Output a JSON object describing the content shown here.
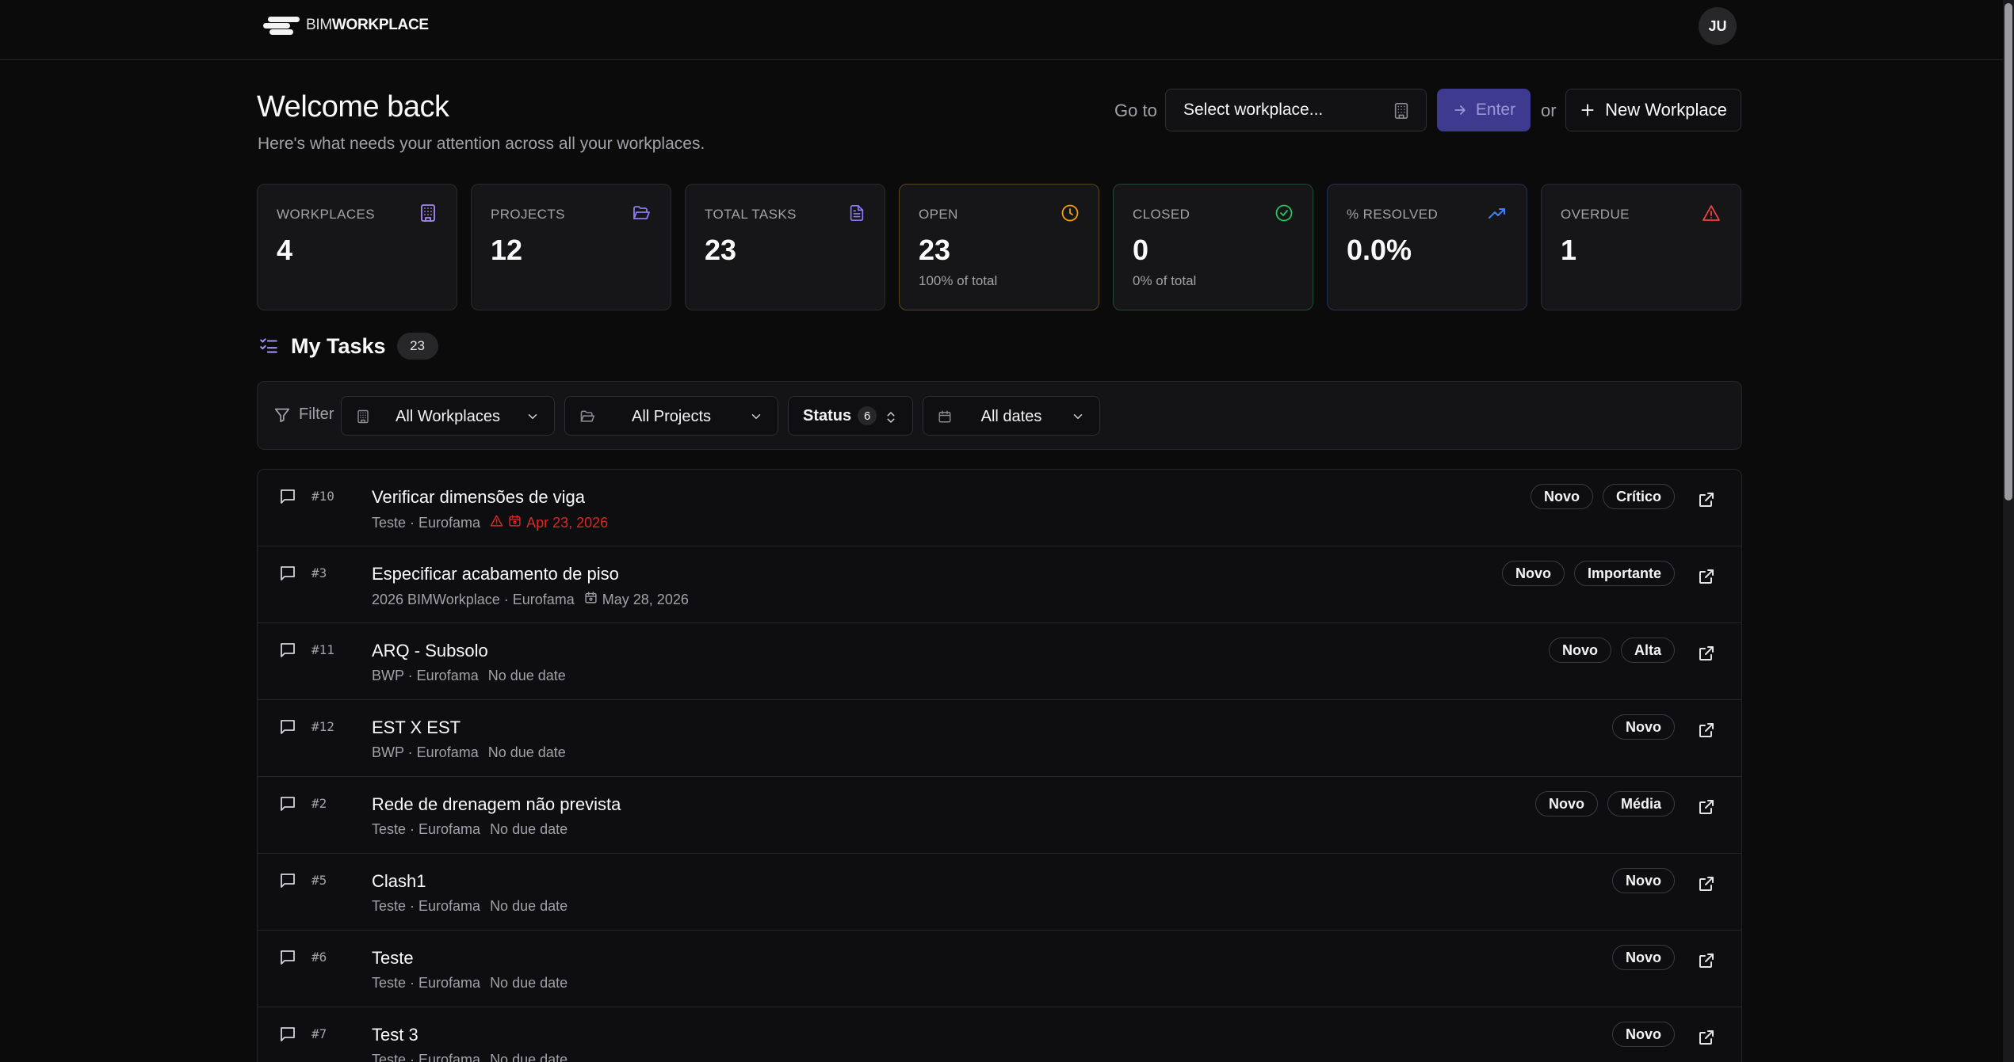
{
  "header": {
    "logo_part1": "BIM",
    "logo_part2": "WORKPLACE",
    "avatar_initials": "JU"
  },
  "welcome": {
    "title": "Welcome back",
    "subtitle": "Here's what needs your attention across all your workplaces."
  },
  "goto": {
    "label": "Go to",
    "select_placeholder": "Select workplace...",
    "enter_label": "Enter",
    "or_label": "or",
    "new_label": "New Workplace"
  },
  "stats": [
    {
      "label": "WORKPLACES",
      "value": "4",
      "sub": "",
      "icon": "building-icon",
      "color": "#a78bfa"
    },
    {
      "label": "PROJECTS",
      "value": "12",
      "sub": "",
      "icon": "folder-open-icon",
      "color": "#8b7cf6"
    },
    {
      "label": "TOTAL TASKS",
      "value": "23",
      "sub": "",
      "icon": "file-text-icon",
      "color": "#8b7cf6"
    },
    {
      "label": "OPEN",
      "value": "23",
      "sub": "100% of total",
      "icon": "clock-icon",
      "color": "#f59e0b"
    },
    {
      "label": "CLOSED",
      "value": "0",
      "sub": "0% of total",
      "icon": "check-circle-icon",
      "color": "#22c55e"
    },
    {
      "label": "% RESOLVED",
      "value": "0.0%",
      "sub": "",
      "icon": "trending-up-icon",
      "color": "#3b82f6"
    },
    {
      "label": "OVERDUE",
      "value": "1",
      "sub": "",
      "icon": "alert-triangle-icon",
      "color": "#ef4444"
    }
  ],
  "tasks_section": {
    "title": "My Tasks",
    "count": "23"
  },
  "filters": {
    "label": "Filter",
    "workplaces": "All Workplaces",
    "projects": "All Projects",
    "status": "Status",
    "status_count": "6",
    "dates": "All dates"
  },
  "tasks": [
    {
      "num": "#10",
      "title": "Verificar dimensões de viga",
      "meta": "Teste · Eurofama",
      "due": "Apr 23, 2026",
      "overdue": true,
      "tags": [
        "Novo",
        "Crítico"
      ]
    },
    {
      "num": "#3",
      "title": "Especificar acabamento de piso",
      "meta": "2026 BIMWorkplace · Eurofama",
      "due": "May 28, 2026",
      "overdue": false,
      "tags": [
        "Novo",
        "Importante"
      ]
    },
    {
      "num": "#11",
      "title": "ARQ - Subsolo",
      "meta": "BWP · Eurofama",
      "due": "No due date",
      "overdue": false,
      "tags": [
        "Novo",
        "Alta"
      ]
    },
    {
      "num": "#12",
      "title": "EST X EST",
      "meta": "BWP · Eurofama",
      "due": "No due date",
      "overdue": false,
      "tags": [
        "Novo"
      ]
    },
    {
      "num": "#2",
      "title": "Rede de drenagem não prevista",
      "meta": "Teste · Eurofama",
      "due": "No due date",
      "overdue": false,
      "tags": [
        "Novo",
        "Média"
      ]
    },
    {
      "num": "#5",
      "title": "Clash1",
      "meta": "Teste · Eurofama",
      "due": "No due date",
      "overdue": false,
      "tags": [
        "Novo"
      ]
    },
    {
      "num": "#6",
      "title": "Teste",
      "meta": "Teste · Eurofama",
      "due": "No due date",
      "overdue": false,
      "tags": [
        "Novo"
      ]
    },
    {
      "num": "#7",
      "title": "Test 3",
      "meta": "Teste · Eurofama",
      "due": "No due date",
      "overdue": false,
      "tags": [
        "Novo"
      ]
    }
  ]
}
